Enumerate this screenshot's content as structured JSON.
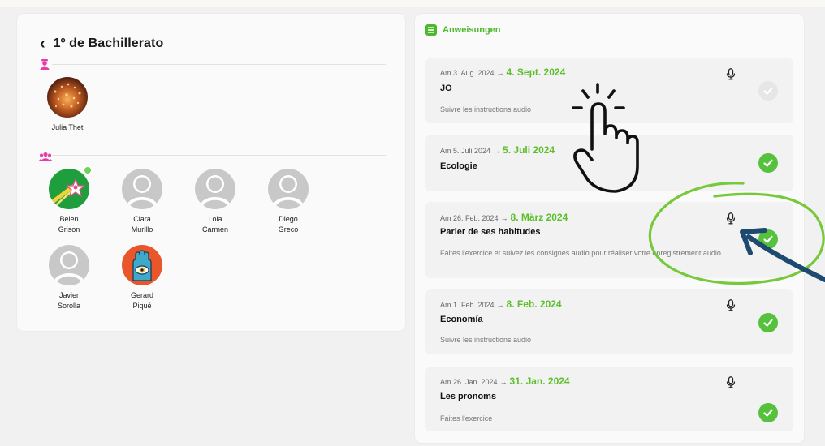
{
  "class_title": "1º de Bachillerato",
  "teachers": [
    {
      "name": "Julia Thet",
      "avatar": "photo-lights"
    }
  ],
  "students": [
    {
      "name_line1": "Belen",
      "name_line2": "Grison",
      "avatar": "shooting-star",
      "online": true
    },
    {
      "name_line1": "Clara",
      "name_line2": "Murillo",
      "avatar": "generic-user"
    },
    {
      "name_line1": "Lola",
      "name_line2": "Carmen",
      "avatar": "generic-user"
    },
    {
      "name_line1": "Diego",
      "name_line2": "Greco",
      "avatar": "generic-user"
    },
    {
      "name_line1": "Javier",
      "name_line2": "Sorolla",
      "avatar": "generic-user"
    },
    {
      "name_line1": "Gerard",
      "name_line2": "Piqué",
      "avatar": "hamsa-eye"
    }
  ],
  "instructions": {
    "title": "Anweisungen",
    "tasks": [
      {
        "from": "Am 3. Aug. 2024",
        "arrow": "→",
        "due": "4. Sept. 2024",
        "title": "JO",
        "desc": "Suivre les instructions audio",
        "has_audio": true,
        "completed": false
      },
      {
        "from": "Am 5. Juli 2024",
        "arrow": "→",
        "due": "5. Juli 2024",
        "title": "Ecologie",
        "desc": "",
        "has_audio": false,
        "completed": true
      },
      {
        "from": "Am 26. Feb. 2024",
        "arrow": "→",
        "due": "8. März 2024",
        "title": "Parler de ses habitudes",
        "desc": "Faites l'exercice et suivez les consignes audio pour réaliser votre enregistrement audio.",
        "has_audio": true,
        "completed": true
      },
      {
        "from": "Am 1. Feb. 2024",
        "arrow": "→",
        "due": "8. Feb. 2024",
        "title": "Economía",
        "desc": "Suivre les instructions audio",
        "has_audio": true,
        "completed": true
      },
      {
        "from": "Am 26. Jan. 2024",
        "arrow": "→",
        "due": "31. Jan. 2024",
        "title": "Les pronoms",
        "desc": "Faites l'exercice",
        "has_audio": true,
        "completed": true
      }
    ]
  },
  "colors": {
    "accent_green": "#5cbf2a",
    "check_green": "#55c13c",
    "section_pink": "#e83aa8",
    "annotation_blue": "#1d4a6e"
  },
  "icons": {
    "back": "chevron-left-icon",
    "teacher": "teacher-icon",
    "students": "group-icon",
    "instructions": "list-icon",
    "audio": "microphone-icon",
    "status": "checkmark-icon",
    "annotation_hand": "tap-hand-icon"
  }
}
